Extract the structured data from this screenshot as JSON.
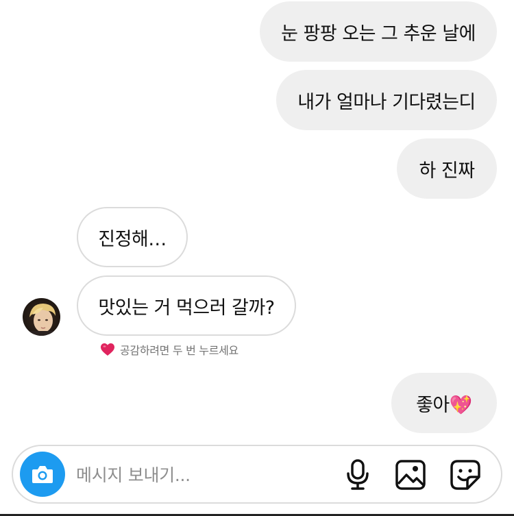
{
  "messages": [
    {
      "sender": "me",
      "text": "눈 팡팡 오는 그 추운 날에"
    },
    {
      "sender": "me",
      "text": "내가 얼마나 기다렸는디"
    },
    {
      "sender": "me",
      "text": "하 진짜"
    },
    {
      "sender": "other",
      "text": "진정해…"
    },
    {
      "sender": "other",
      "text": "맛있는 거 먹으러 갈까?"
    },
    {
      "sender": "me",
      "text": "좋아💖"
    }
  ],
  "reaction_hint": "공감하려면 두 번 누르세요",
  "composer": {
    "placeholder": "메시지 보내기...",
    "value": ""
  },
  "icons": {
    "camera": "camera-icon",
    "mic": "microphone-icon",
    "gallery": "gallery-icon",
    "sticker": "sticker-icon",
    "heart": "heart-icon",
    "avatar": "avatar"
  },
  "colors": {
    "sent_bubble": "#efefef",
    "received_border": "#dbdbdb",
    "camera_button": "#1d9bf0",
    "heart": "#e0245e",
    "hint_text": "#737373",
    "placeholder": "#8e8e8e"
  }
}
